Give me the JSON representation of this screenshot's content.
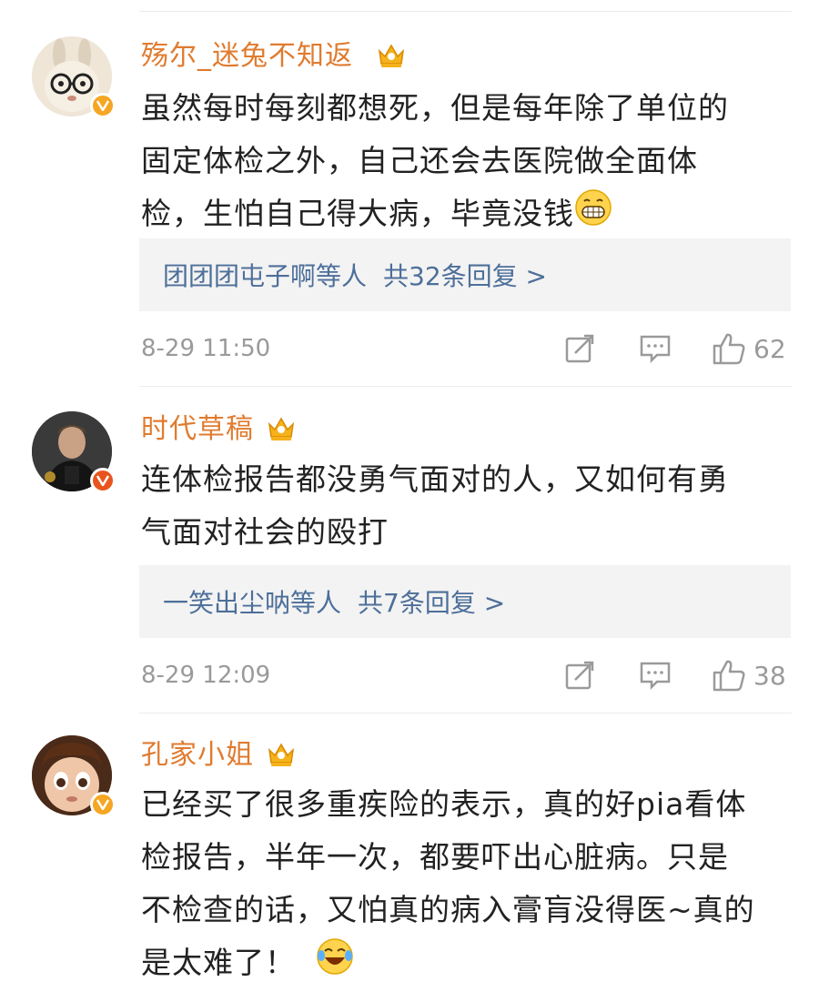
{
  "comments": [
    {
      "username": "殇尔_迷兔不知返",
      "text_lines": [
        "虽然每时每刻都想死，但是每年除了单位的",
        "固定体检之外，自己还会去医院做全面体",
        "检，生怕自己得大病，毕竟没钱"
      ],
      "reply_names": "团团团屯子啊等人",
      "reply_count": "共32条回复 >",
      "time": "8-29 11:50",
      "likes": "62",
      "trailing_emoji": "grin-emoji"
    },
    {
      "username": "时代草稿",
      "text_lines": [
        "连体检报告都没勇气面对的人，又如何有勇",
        "气面对社会的殴打"
      ],
      "reply_names": "一笑出尘呐等人",
      "reply_count": "共7条回复 >",
      "time": "8-29 12:09",
      "likes": "38"
    },
    {
      "username": "孔家小姐",
      "text_lines": [
        "已经买了很多重疾险的表示，真的好pia看体",
        "检报告，半年一次，都要吓出心脏病。只是",
        "不检查的话，又怕真的病入膏肓没得医~真的",
        "是太难了！"
      ],
      "trailing_emoji": "laugh-cry-emoji"
    }
  ],
  "colors": {
    "username": "#e07b2f",
    "reply_link": "#4d6f9a",
    "meta": "#9a9a9a",
    "verified_gold": "#f5a623",
    "verified_orange": "#e8541e"
  }
}
